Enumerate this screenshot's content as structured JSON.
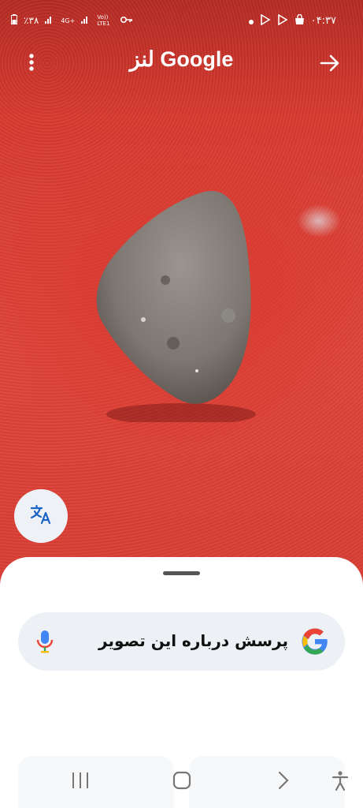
{
  "status_bar": {
    "battery": "٪۳۸",
    "network_4g": "4G+",
    "volte": "Vo)) LTE1",
    "time": "۰۴:۳۷",
    "icons": [
      "battery-icon",
      "signal-icon",
      "key-icon",
      "dot-icon",
      "play-store-icon",
      "bag-icon"
    ]
  },
  "header": {
    "title": "لنز Google",
    "menu_icon": "more-vert-icon",
    "action_icon": "arrow-right-icon"
  },
  "translate_button": {
    "icon": "translate-icon"
  },
  "bottom_sheet": {
    "search_text": "پرسش درباره این تصویر",
    "logo_icon": "google-g-icon",
    "mic_icon": "mic-icon"
  },
  "nav_bar": {
    "buttons": [
      "recents-icon",
      "home-icon",
      "back-icon",
      "accessibility-icon"
    ]
  },
  "colors": {
    "background_red": "#e0443a",
    "sheet": "#ffffff",
    "search_pill": "#edf0f4",
    "google_blue": "#4285F4",
    "google_red": "#EA4335",
    "google_yellow": "#FBBC05",
    "google_green": "#34A853"
  }
}
